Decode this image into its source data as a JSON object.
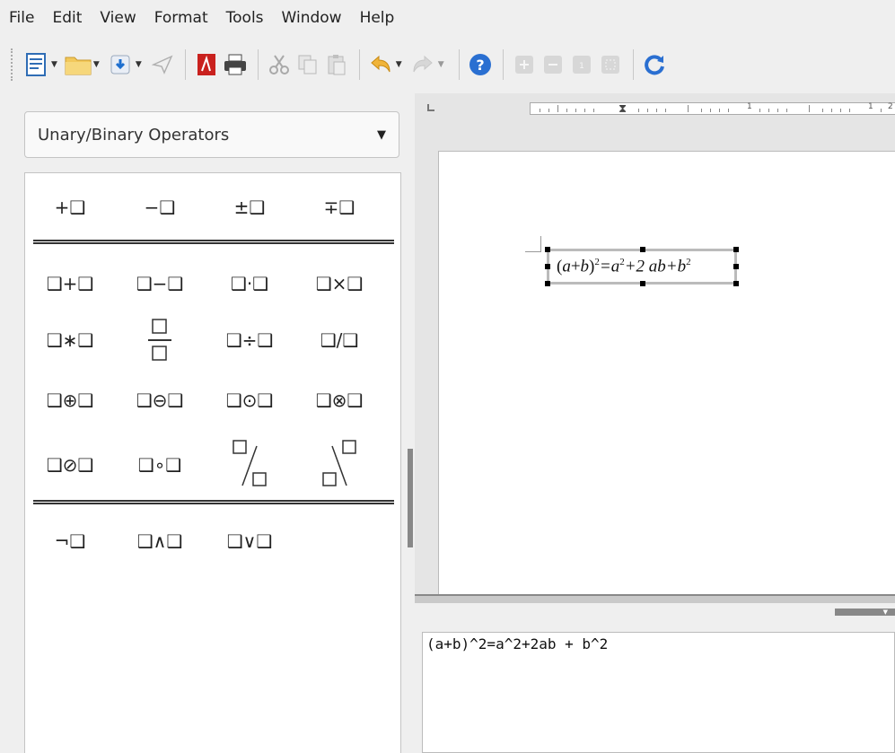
{
  "menu": [
    "File",
    "Edit",
    "View",
    "Format",
    "Tools",
    "Window",
    "Help"
  ],
  "toolbar": {
    "icons": [
      "new-document-icon",
      "open-folder-icon",
      "save-icon",
      "send-icon",
      "export-pdf-icon",
      "print-icon",
      "cut-icon",
      "copy-icon",
      "paste-icon",
      "undo-icon",
      "redo-icon",
      "help-icon",
      "zoom-in-icon",
      "zoom-out-icon",
      "zoom-100-icon",
      "show-all-icon",
      "update-icon"
    ]
  },
  "sidebar": {
    "category": "Unary/Binary Operators",
    "elements": [
      "+❑",
      "−❑",
      "±❑",
      "∓❑",
      "❑+❑",
      "❑−❑",
      "❑·❑",
      "❑×❑",
      "❑∗❑",
      "❑÷❑",
      "❑/❑",
      "❑⊕❑",
      "❑⊖❑",
      "❑⊙❑",
      "❑⊗❑",
      "❑⊘❑",
      "❑∘❑",
      "¬❑",
      "❑∧❑",
      "❑∨❑"
    ]
  },
  "ruler": {
    "labels": [
      "1",
      "1",
      "2"
    ]
  },
  "formula": {
    "open": "(",
    "a": "a",
    "plus": "+",
    "b": "b",
    "close": ")",
    "sup": "2",
    "rest": "=a",
    "sup2": "2",
    "rest2": "+2 ab+b",
    "sup3": "2"
  },
  "editor": {
    "text": "(a+b)^2=a^2+2ab + b^2"
  },
  "colors": {
    "accent": "#1e6fcf",
    "pdf": "#c9211e",
    "help": "#2a6fd1"
  }
}
